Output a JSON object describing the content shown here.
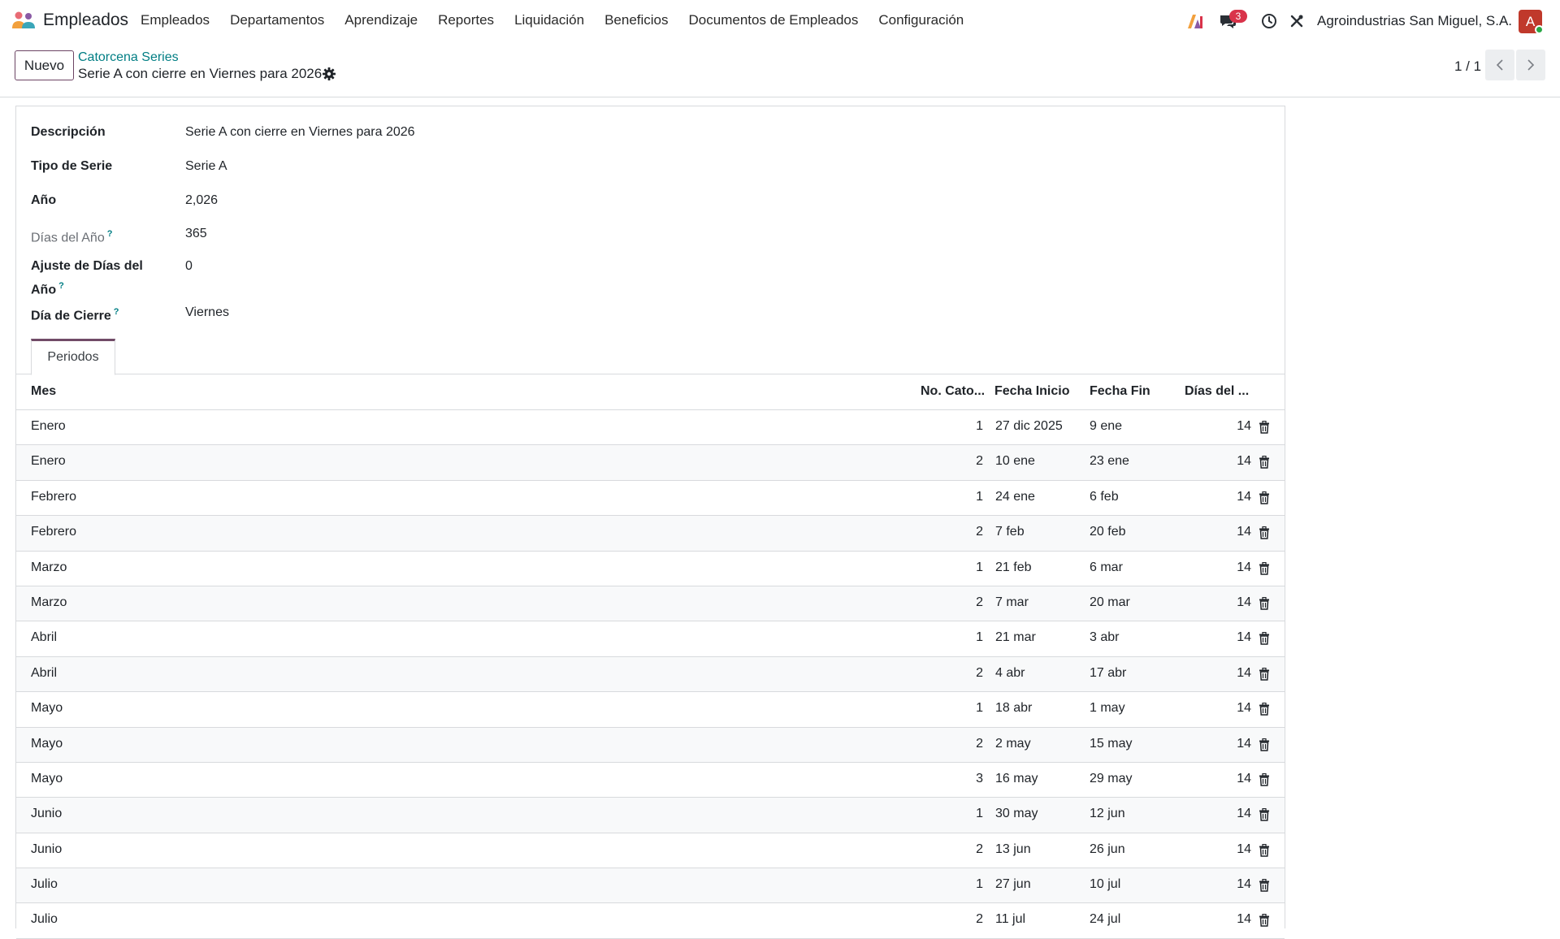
{
  "navbar": {
    "app_name": "Empleados",
    "menu": [
      "Empleados",
      "Departamentos",
      "Aprendizaje",
      "Reportes",
      "Liquidación",
      "Beneficios",
      "Documentos de Empleados",
      "Configuración"
    ],
    "messages_count": "3",
    "company": "Agroindustrias San Miguel, S.A.",
    "avatar_letter": "A"
  },
  "control": {
    "new_button": "Nuevo",
    "breadcrumb_parent": "Catorcena Series",
    "breadcrumb_current": "Serie A con cierre en Viernes para 2026",
    "pager": "1 / 1"
  },
  "form": {
    "fields": [
      {
        "label": "Descripción",
        "value": "Serie A con cierre en Viernes para 2026"
      },
      {
        "label": "Tipo de Serie",
        "value": "Serie A"
      },
      {
        "label": "Año",
        "value": "2,026"
      },
      {
        "label": "Días del Año",
        "value": "365",
        "help": "?"
      },
      {
        "label_line1": "Ajuste de Días del",
        "label_line2": "Año",
        "value": "0",
        "help": "?"
      },
      {
        "label": "Día de Cierre",
        "value": "Viernes",
        "help": "?"
      }
    ]
  },
  "tabs": [
    "Periodos"
  ],
  "table": {
    "headers": [
      "Mes",
      "No. Cato...",
      "Fecha Inicio",
      "Fecha Fin",
      "Días del ..."
    ],
    "rows": [
      [
        "Enero",
        "1",
        "27 dic 2025",
        "9 ene",
        "14"
      ],
      [
        "Enero",
        "2",
        "10 ene",
        "23 ene",
        "14"
      ],
      [
        "Febrero",
        "1",
        "24 ene",
        "6 feb",
        "14"
      ],
      [
        "Febrero",
        "2",
        "7 feb",
        "20 feb",
        "14"
      ],
      [
        "Marzo",
        "1",
        "21 feb",
        "6 mar",
        "14"
      ],
      [
        "Marzo",
        "2",
        "7 mar",
        "20 mar",
        "14"
      ],
      [
        "Abril",
        "1",
        "21 mar",
        "3 abr",
        "14"
      ],
      [
        "Abril",
        "2",
        "4 abr",
        "17 abr",
        "14"
      ],
      [
        "Mayo",
        "1",
        "18 abr",
        "1 may",
        "14"
      ],
      [
        "Mayo",
        "2",
        "2 may",
        "15 may",
        "14"
      ],
      [
        "Mayo",
        "3",
        "16 may",
        "29 may",
        "14"
      ],
      [
        "Junio",
        "1",
        "30 may",
        "12 jun",
        "14"
      ],
      [
        "Junio",
        "2",
        "13 jun",
        "26 jun",
        "14"
      ],
      [
        "Julio",
        "1",
        "27 jun",
        "10 jul",
        "14"
      ],
      [
        "Julio",
        "2",
        "11 jul",
        "24 jul",
        "14"
      ]
    ]
  },
  "icons": {
    "app": "employees-app-icon",
    "ai": "ai-assistant-icon",
    "chat": "chat-icon",
    "clock": "activity-clock-icon",
    "tools": "debug-tools-icon",
    "gear": "gear-icon",
    "prev": "chevron-left-icon",
    "next": "chevron-right-icon",
    "trash": "trash-icon"
  },
  "colors": {
    "brand": "#714b67",
    "link": "#017e84",
    "badge": "#d9334a",
    "avatar": "#c0392b"
  }
}
